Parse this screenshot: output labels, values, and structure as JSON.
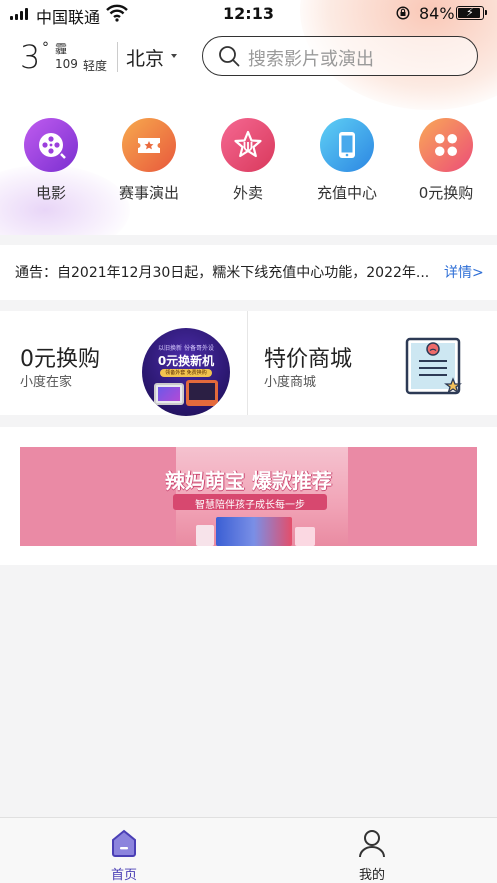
{
  "status_bar": {
    "carrier": "中国联通",
    "time": "12:13",
    "battery_percent": "84%",
    "battery_level": 0.84,
    "icons": [
      "signal-icon",
      "wifi-icon",
      "rotation-lock-icon",
      "battery-charging-icon"
    ]
  },
  "header": {
    "temperature": "3",
    "degree_symbol": "°",
    "condition": "霾",
    "aqi": "109",
    "aqi_level": "轻度",
    "city": "北京",
    "search_placeholder": "搜索影片或演出"
  },
  "quick_nav": [
    {
      "label": "电影",
      "icon": "film-reel-icon",
      "color_from": "#b44ee6",
      "color_to": "#7a2fd0"
    },
    {
      "label": "赛事演出",
      "icon": "ticket-icon",
      "color_from": "#f6a14a",
      "color_to": "#e95a3c"
    },
    {
      "label": "外卖",
      "icon": "takeout-star-icon",
      "color_from": "#f45f8f",
      "color_to": "#d93a5d"
    },
    {
      "label": "充值中心",
      "icon": "phone-icon",
      "color_from": "#57c5f2",
      "color_to": "#2f8ee6"
    },
    {
      "label": "0元换购",
      "icon": "grid-icon",
      "color_from": "#f8a057",
      "color_to": "#ec4e77"
    }
  ],
  "notice": {
    "text": "通告：自2021年12月30日起，糯米下线充值中心功能，2022年...",
    "link": "详情>"
  },
  "promo_cards": [
    {
      "title": "0元换购",
      "subtitle": "小度在家",
      "image": {
        "top_text": "以旧换新  份备哥外设",
        "main_text": "0元换新机",
        "badge_text": "领备外套  免费换购"
      }
    },
    {
      "title": "特价商城",
      "subtitle": "小度商城",
      "image_icon": "price-list-icon"
    }
  ],
  "banner": {
    "title": "辣妈萌宝  爆款推荐",
    "subtitle": "智慧陪伴孩子成长每一步"
  },
  "tab_bar": [
    {
      "label": "首页",
      "icon": "home-icon",
      "active": true
    },
    {
      "label": "我的",
      "icon": "profile-icon",
      "active": false
    }
  ],
  "colors": {
    "accent": "#5b4fc4",
    "link": "#2f6fd6",
    "banner_bg": "#ea8aa5"
  }
}
